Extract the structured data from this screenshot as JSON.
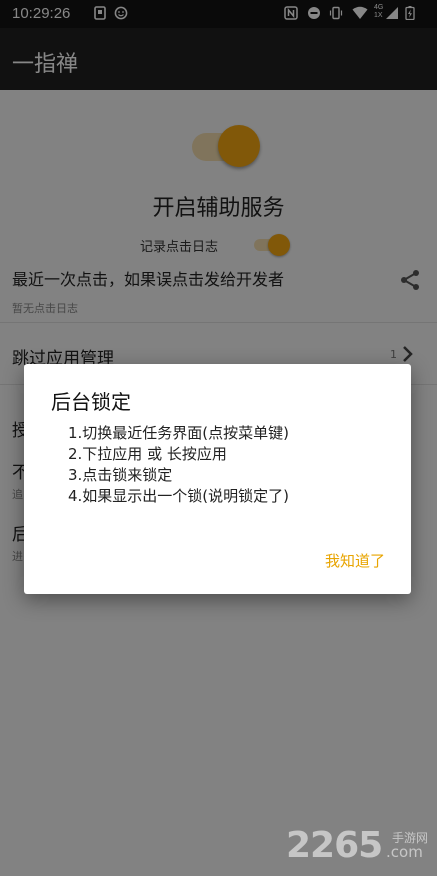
{
  "status_bar": {
    "time": "10:29:26",
    "icons": [
      "notification-icon",
      "emoji-icon",
      "nfc-icon",
      "dnd-icon",
      "vibrate-icon",
      "wifi-icon",
      "signal-4g-icon",
      "battery-charging-icon"
    ],
    "network_top": "4G",
    "network_bottom": "1X"
  },
  "app_bar": {
    "title": "一指禅"
  },
  "main": {
    "service_toggle_on": true,
    "service_title": "开启辅助服务",
    "log_label": "记录点击日志",
    "log_toggle_on": true,
    "recent_click": "最近一次点击，如果误点击发给开发者",
    "share_icon": "share-icon",
    "no_log": "暂无点击日志",
    "skip_apps": "跳过应用管理",
    "skip_count": "1",
    "partial_rows": [
      "授",
      "不",
      "追",
      "后",
      "进"
    ]
  },
  "dialog": {
    "title": "后台锁定",
    "lines": [
      "1.切换最近任务界面(点按菜单键)",
      "2.下拉应用 或 长按应用",
      "3.点击锁来锁定",
      "4.如果显示出一个锁(说明锁定了)"
    ],
    "ok_label": "我知道了"
  },
  "watermark": {
    "number": "2265",
    "cn": "手游网",
    "domain": ".com"
  },
  "colors": {
    "accent": "#f3a712",
    "accent_light": "#f1dcae",
    "app_bar": "#212121",
    "dialog_button": "#e8a400"
  }
}
